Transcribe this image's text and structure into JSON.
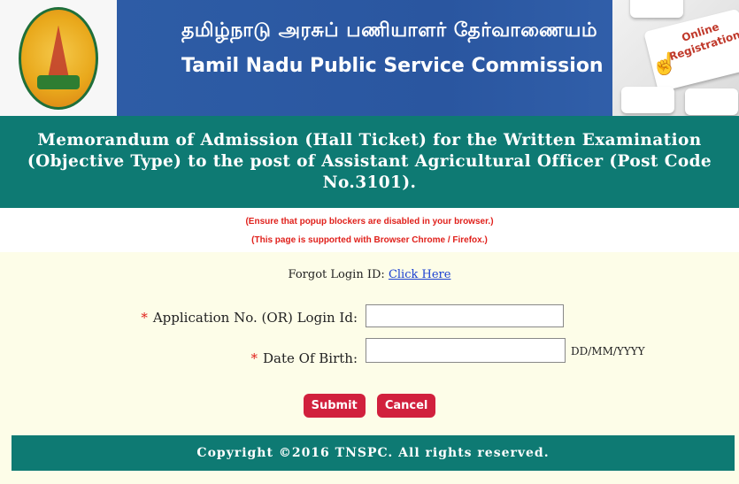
{
  "header": {
    "title_tamil": "தமிழ்நாடு அரசுப் பணியாளர் தேர்வாணையம்",
    "title_english": "Tamil Nadu Public Service Commission",
    "keyboard_key_text_line1": "Online",
    "keyboard_key_text_line2": "Registration"
  },
  "banner": {
    "text": "Memorandum of Admission (Hall Ticket) for the Written Examination (Objective Type) to the post of Assistant Agricultural Officer (Post Code No.3101)."
  },
  "notices": {
    "popup": "(Ensure that popup blockers are disabled in your browser.)",
    "browser": "(This page is supported with Browser Chrome / Firefox.)"
  },
  "form": {
    "forgot_prefix": "Forgot Login ID:",
    "forgot_link": "Click Here",
    "required_mark": "*",
    "app_no_label": "Application No. (OR) Login Id:",
    "app_no_value": "",
    "dob_label": "Date Of Birth:",
    "dob_value": "",
    "dob_hint": "DD/MM/YYYY",
    "submit_label": "Submit",
    "cancel_label": "Cancel"
  },
  "footer": {
    "text": "Copyright ©2016 TNSPC. All rights reserved."
  },
  "colors": {
    "header_blue": "#2a56a0",
    "teal": "#0e7a73",
    "button_red": "#d1203d",
    "notice_red": "#e0201b",
    "link_blue": "#1a3fd1"
  }
}
